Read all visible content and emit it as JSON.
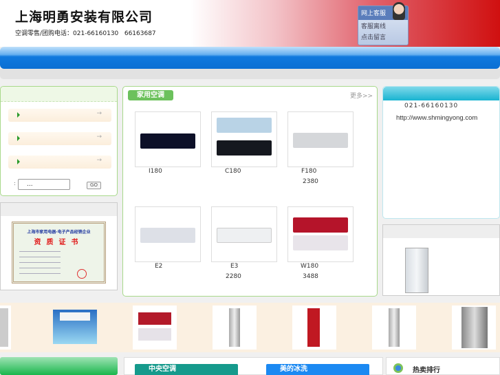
{
  "header": {
    "company": "上海明勇安装有限公司",
    "phone_line": "空调零售/团购电话：021-66160130   66163687"
  },
  "customer_service": {
    "title": "网上客服",
    "items": [
      "客服离线",
      "点击留言"
    ]
  },
  "search": {
    "value": "...",
    "go_label": "GO",
    "prefix": ":"
  },
  "certificate": {
    "title": "上海市家用电器·电子产品经销企业",
    "subtitle": "资质证书"
  },
  "main": {
    "tab": "家用空调",
    "more": "更多>>",
    "products": [
      {
        "name": "I180",
        "price": ""
      },
      {
        "name": "C180",
        "price": ""
      },
      {
        "name": "F180",
        "price": "2380"
      },
      {
        "name": "E2",
        "price": ""
      },
      {
        "name": "E3",
        "price": "2280"
      },
      {
        "name": "W180",
        "price": "3488"
      }
    ]
  },
  "contact": {
    "phone": "021-66160130",
    "url": "http://www.shmingyong.com"
  },
  "bottom": {
    "tab_central": "中央空调",
    "tab_midea": "美的冰洗",
    "hot": "热卖排行"
  },
  "colors": {
    "nav": "#0b6fd3",
    "green_border": "#a8d98a",
    "tab_green": "#6cc15c"
  }
}
